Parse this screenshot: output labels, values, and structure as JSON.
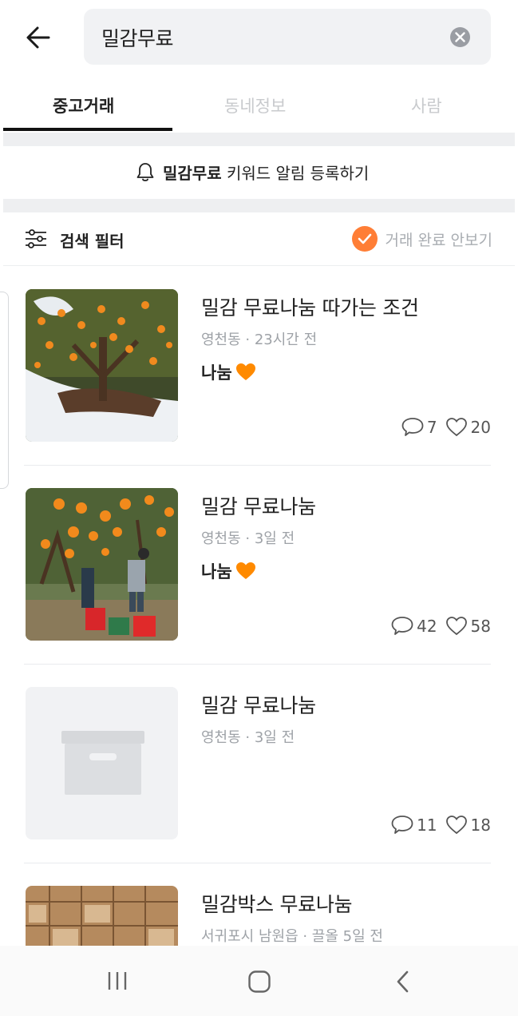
{
  "search": {
    "query": "밀감무료"
  },
  "tabs": [
    {
      "label": "중고거래",
      "active": true
    },
    {
      "label": "동네정보",
      "active": false
    },
    {
      "label": "사람",
      "active": false
    }
  ],
  "alert": {
    "keyword": "밀감무료",
    "text": " 키워드 알림 등록하기",
    "icon": "bell-icon"
  },
  "filter": {
    "label": "검색 필터",
    "hide_completed_label": "거래 완료 안보기",
    "hide_completed_checked": true
  },
  "colors": {
    "accent": "#ff7e36",
    "heart": "#ff8a00"
  },
  "listings": [
    {
      "title": "밀감 무료나눔 따가는 조건",
      "meta": "영천동 · 23시간 전",
      "price": "나눔",
      "comments": "7",
      "likes": "20",
      "image": "snowy-tangerine-tree"
    },
    {
      "title": "밀감 무료나눔",
      "meta": "영천동 · 3일 전",
      "price": "나눔",
      "comments": "42",
      "likes": "58",
      "image": "tangerine-harvest"
    },
    {
      "title": "밀감 무료나눔",
      "meta": "영천동 · 3일 전",
      "price": "",
      "comments": "11",
      "likes": "18",
      "image": "placeholder-box"
    },
    {
      "title": "밀감박스 무료나눔",
      "meta": "서귀포시 남원읍 · 끌올 5일 전",
      "price": "",
      "comments": "",
      "likes": "",
      "image": "wooden-crates"
    }
  ],
  "navbar": {
    "icons": [
      "recent-apps-icon",
      "home-icon",
      "back-nav-icon"
    ]
  }
}
